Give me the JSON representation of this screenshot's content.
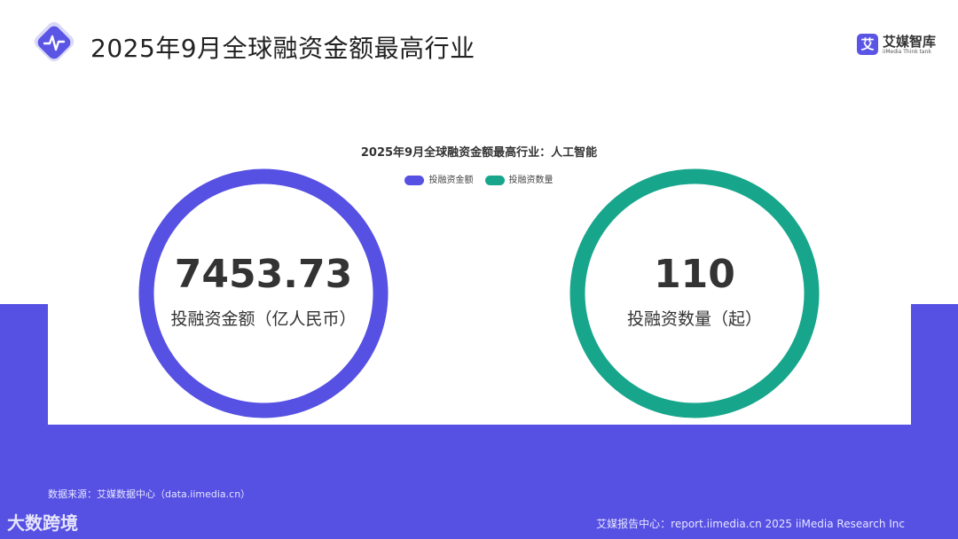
{
  "header": {
    "title": "2025年9月全球融资金额最高行业",
    "brand_name": "艾媒智库",
    "brand_tagline": "iiMedia Think tank",
    "brand_mark": "艾",
    "logo_icon": "pulse-wave-icon"
  },
  "chart_data": {
    "type": "ring",
    "title": "2025年9月全球融资金额最高行业：人工智能",
    "legend_position": "top-center",
    "series": [
      {
        "name": "投融资金额",
        "value": 7453.73,
        "display_value": "7453.73",
        "label": "投融资金额（亿人民币）",
        "color": "#5650e3"
      },
      {
        "name": "投融资数量",
        "value": 110,
        "display_value": "110",
        "label": "投融资数量（起）",
        "color": "#17a68c"
      }
    ]
  },
  "footer": {
    "source": "数据来源：艾媒数据中心（data.iimedia.cn）",
    "watermark": "大数跨境",
    "right_text": "艾媒报告中心：report.iimedia.cn   2025 iiMedia Research Inc"
  },
  "colors": {
    "band": "#5650e3",
    "ring_amount": "#5650e3",
    "ring_count": "#17a68c"
  }
}
